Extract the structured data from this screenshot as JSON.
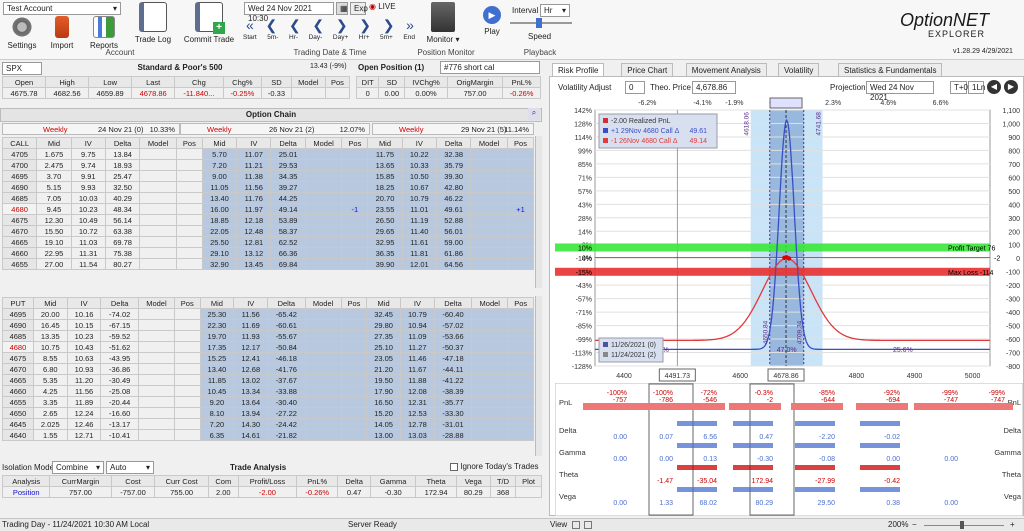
{
  "toolbar": {
    "account": "Test Account",
    "settings": "Settings",
    "import": "Import",
    "reports": "Reports",
    "tradelog": "Trade Log",
    "commit": "Commit Trade",
    "account_group": "Account",
    "date": "Wed 24 Nov 2021 10:30",
    "exp": "Exp",
    "live": "LIVE",
    "start": "Start",
    "m5": "5m-",
    "hm": "Hr-",
    "dm": "Day-",
    "dp": "Day+",
    "hp": "Hr+",
    "mp": "5m+",
    "end": "End",
    "tdt": "Trading Date & Time",
    "monitor": "Monitor",
    "pos_monitor": "Position Monitor",
    "play": "Play",
    "interval_label": "Interval",
    "interval": "Hr",
    "speed": "Speed",
    "playback": "Playback",
    "brand1": "OptionNET",
    "brand2": "EXPLORER",
    "version": "v1.28.29",
    "ver_date": "4/29/2021"
  },
  "underlying": {
    "symbol": "SPX",
    "name": "Standard & Poor's 500",
    "change": "13.43 (-9%)",
    "headers": [
      "Open",
      "High",
      "Low",
      "Last",
      "Chg",
      "Chg%",
      "SD",
      "Model",
      "Pos"
    ],
    "values": [
      "4675.78",
      "4682.56",
      "4659.89",
      "4678.86",
      "-11.840...",
      "-0.25%",
      "-0.33",
      "",
      ""
    ]
  },
  "open_position": {
    "title": "Open Position (1)",
    "name": "#776 short cal",
    "headers": [
      "DIT",
      "SD",
      "IVChg%",
      "OrigMargin",
      "PnL%"
    ],
    "values": [
      "0",
      "0.00",
      "0.00%",
      "757.00",
      "-0.26%"
    ]
  },
  "chain": {
    "title": "Option Chain",
    "header": [
      {
        "type": "Weekly",
        "date": "24 Nov 21 (0)",
        "iv": "10.33%"
      },
      {
        "type": "Weekly",
        "date": "26 Nov 21 (2)",
        "iv": "12.07%"
      },
      {
        "type": "Weekly",
        "date": "29 Nov 21 (5)",
        "iv": "11.14%"
      }
    ],
    "cols_left": [
      "CALL",
      "Mid",
      "IV",
      "Delta",
      "Model",
      "Pos"
    ],
    "cols": [
      "Mid",
      "IV",
      "Delta",
      "Model",
      "Pos"
    ],
    "calls": [
      [
        "4705",
        "1.675",
        "9.75",
        "13.84",
        "",
        "",
        "5.70",
        "11.07",
        "25.01",
        "",
        "",
        "11.75",
        "10.22",
        "32.38",
        "",
        ""
      ],
      [
        "4700",
        "2.475",
        "9.74",
        "18.93",
        "",
        "",
        "7.20",
        "11.21",
        "29.53",
        "",
        "",
        "13.65",
        "10.33",
        "35.79",
        "",
        ""
      ],
      [
        "4695",
        "3.70",
        "9.91",
        "25.47",
        "",
        "",
        "9.00",
        "11.38",
        "34.35",
        "",
        "",
        "15.85",
        "10.50",
        "39.30",
        "",
        ""
      ],
      [
        "4690",
        "5.15",
        "9.93",
        "32.50",
        "",
        "",
        "11.05",
        "11.56",
        "39.27",
        "",
        "",
        "18.25",
        "10.67",
        "42.80",
        "",
        ""
      ],
      [
        "4685",
        "7.05",
        "10.03",
        "40.29",
        "",
        "",
        "13.40",
        "11.76",
        "44.25",
        "",
        "",
        "20.70",
        "10.79",
        "46.22",
        "",
        ""
      ],
      [
        "4680",
        "9.45",
        "10.23",
        "48.34",
        "",
        "",
        "16.00",
        "11.97",
        "49.14",
        "",
        "-1",
        "23.55",
        "11.01",
        "49.61",
        "",
        "+1"
      ],
      [
        "4675",
        "12.30",
        "10.49",
        "56.14",
        "",
        "",
        "18.85",
        "12.18",
        "53.89",
        "",
        "",
        "26.50",
        "11.19",
        "52.88",
        "",
        ""
      ],
      [
        "4670",
        "15.50",
        "10.72",
        "63.38",
        "",
        "",
        "22.05",
        "12.48",
        "58.37",
        "",
        "",
        "29.65",
        "11.40",
        "56.01",
        "",
        ""
      ],
      [
        "4665",
        "19.10",
        "11.03",
        "69.78",
        "",
        "",
        "25.50",
        "12.81",
        "62.52",
        "",
        "",
        "32.95",
        "11.61",
        "59.00",
        "",
        ""
      ],
      [
        "4660",
        "22.95",
        "11.31",
        "75.38",
        "",
        "",
        "29.10",
        "13.12",
        "66.36",
        "",
        "",
        "36.35",
        "11.81",
        "61.86",
        "",
        ""
      ],
      [
        "4655",
        "27.00",
        "11.54",
        "80.27",
        "",
        "",
        "32.90",
        "13.45",
        "69.84",
        "",
        "",
        "39.90",
        "12.01",
        "64.56",
        "",
        ""
      ]
    ],
    "puts": [
      [
        "4695",
        "20.00",
        "10.16",
        "-74.02",
        "",
        "",
        "25.30",
        "11.56",
        "-65.42",
        "",
        "",
        "32.45",
        "10.79",
        "-60.40",
        "",
        ""
      ],
      [
        "4690",
        "16.45",
        "10.15",
        "-67.15",
        "",
        "",
        "22.30",
        "11.69",
        "-60.61",
        "",
        "",
        "29.80",
        "10.94",
        "-57.02",
        "",
        ""
      ],
      [
        "4685",
        "13.35",
        "10.23",
        "-59.52",
        "",
        "",
        "19.70",
        "11.93",
        "-55.67",
        "",
        "",
        "27.35",
        "11.09",
        "-53.66",
        "",
        ""
      ],
      [
        "4680",
        "10.75",
        "10.43",
        "-51.62",
        "",
        "",
        "17.35",
        "12.17",
        "-50.84",
        "",
        "",
        "25.10",
        "11.27",
        "-50.37",
        "",
        ""
      ],
      [
        "4675",
        "8.55",
        "10.63",
        "-43.95",
        "",
        "",
        "15.25",
        "12.41",
        "-46.18",
        "",
        "",
        "23.05",
        "11.46",
        "-47.18",
        "",
        ""
      ],
      [
        "4670",
        "6.80",
        "10.93",
        "-36.86",
        "",
        "",
        "13.40",
        "12.68",
        "-41.76",
        "",
        "",
        "21.20",
        "11.67",
        "-44.11",
        "",
        ""
      ],
      [
        "4665",
        "5.35",
        "11.20",
        "-30.49",
        "",
        "",
        "11.85",
        "13.02",
        "-37.67",
        "",
        "",
        "19.50",
        "11.88",
        "-41.22",
        "",
        ""
      ],
      [
        "4660",
        "4.25",
        "11.56",
        "-25.08",
        "",
        "",
        "10.45",
        "13.34",
        "-33.88",
        "",
        "",
        "17.90",
        "12.08",
        "-38.39",
        "",
        ""
      ],
      [
        "4655",
        "3.35",
        "11.89",
        "-20.44",
        "",
        "",
        "9.20",
        "13.64",
        "-30.40",
        "",
        "",
        "16.50",
        "12.31",
        "-35.77",
        "",
        ""
      ],
      [
        "4650",
        "2.65",
        "12.24",
        "-16.60",
        "",
        "",
        "8.10",
        "13.94",
        "-27.22",
        "",
        "",
        "15.20",
        "12.53",
        "-33.30",
        "",
        ""
      ],
      [
        "4645",
        "2.025",
        "12.46",
        "-13.17",
        "",
        "",
        "7.20",
        "14.30",
        "-24.42",
        "",
        "",
        "14.05",
        "12.78",
        "-31.01",
        "",
        ""
      ],
      [
        "4640",
        "1.55",
        "12.71",
        "-10.41",
        "",
        "",
        "6.35",
        "14.61",
        "-21.82",
        "",
        "",
        "13.00",
        "13.03",
        "-28.88",
        "",
        ""
      ]
    ]
  },
  "trade_analysis": {
    "iso_label": "Isolation Mode",
    "iso_val": "Combine",
    "auto": "Auto",
    "title": "Trade Analysis",
    "ignore": "Ignore Today's Trades",
    "headers": [
      "Analysis",
      "CurrMargin",
      "Cost",
      "Curr Cost",
      "Com",
      "Profit/Loss",
      "PnL%",
      "Delta",
      "Gamma",
      "Theta",
      "Vega",
      "T/D",
      "Plot"
    ],
    "values": [
      "Position",
      "757.00",
      "-757.00",
      "755.00",
      "2.00",
      "-2.00",
      "-0.26%",
      "0.47",
      "-0.30",
      "172.94",
      "80.29",
      "368",
      ""
    ]
  },
  "tabs": [
    "Risk Profile",
    "Price Chart",
    "Movement Analysis",
    "Volatility",
    "Statistics & Fundamentals"
  ],
  "risk": {
    "vol_adjust_label": "Volatility Adjust",
    "vol_adjust": "0",
    "theo_label": "Theo. Price",
    "theo": "4,678.86",
    "proj_label": "Projection",
    "proj_date": "Wed 24 Nov 2021",
    "t0": "T+0",
    "oneln": "1Ln",
    "top_pct": [
      "-6.2%",
      "-4.1%",
      "-1.9%",
      "-0.3%",
      "2.3%",
      "4.6%",
      "6.6%"
    ],
    "left_pct": [
      "142%",
      "128%",
      "114%",
      "99%",
      "85%",
      "71%",
      "57%",
      "43%",
      "28%",
      "14%",
      "0%",
      "-14%",
      "-28%",
      "-43%",
      "-57%",
      "-71%",
      "-85%",
      "-99%",
      "-113%",
      "-128%"
    ],
    "right_usd": [
      "1,100",
      "1,000",
      "900",
      "800",
      "700",
      "600",
      "500",
      "400",
      "300",
      "200",
      "100",
      "0",
      "-100",
      "-200",
      "-300",
      "-400",
      "-500",
      "-600",
      "-700",
      "-800"
    ],
    "x_ticks": [
      "4400",
      "4491.73",
      "4600",
      "4678.86",
      "4800",
      "4900",
      "5000"
    ],
    "legend1": [
      "-2.00 Realized PnL",
      "+1 29Nov 4680 Call Δ",
      "-1 26Nov 4680 Call Δ"
    ],
    "legend1_vals": [
      "",
      "49.61",
      "49.14"
    ],
    "legend2": [
      "11/26/2021 (0)",
      "11/24/2021 (2)"
    ],
    "profit_target": "Profit Target 76",
    "pt_val": "76",
    "pt_pct": "10%",
    "max_loss": "Max Loss -114",
    "ml_pct": "-15%",
    "zero_pct": "0%",
    "zero_val": "-2",
    "ann_274": "27.4%",
    "ann_470": "47.0%",
    "ann_256": "25.6%",
    "ann_4650": "4650.84",
    "ann_4709": "4709.34",
    "ann_a": "4618.06",
    "ann_b": "4741.68",
    "colors": {
      "blue": "#3a4ec4",
      "red": "#e03a3a",
      "band": "#c9e3f7",
      "band2": "#99b8de"
    }
  },
  "greeks": {
    "labels": [
      "PnL",
      "Delta",
      "Gamma",
      "Theta",
      "Vega"
    ],
    "col1": {
      "pnl_pct": "-100%",
      "pnl": "-757",
      "delta": "0.00",
      "gamma": "0.00",
      "theta": "",
      "vega": "0.00"
    },
    "col2": {
      "pnl_pct": "-100%",
      "pnl": "-786",
      "delta": "0.07",
      "gamma": "0.00",
      "theta": "-1.47",
      "vega": "1.33"
    },
    "col3": {
      "pnl_pct": "-72%",
      "pnl": "-546",
      "delta": "6.56",
      "gamma": "0.13",
      "theta": "-35.04",
      "vega": "68.02"
    },
    "col4": {
      "pnl_pct": "-0.3%",
      "pnl": "-2",
      "delta": "0.47",
      "gamma": "-0.30",
      "theta": "172.94",
      "vega": "80.29"
    },
    "col5": {
      "pnl_pct": "-85%",
      "pnl": "-644",
      "delta": "-2.20",
      "gamma": "-0.08",
      "theta": "-27.99",
      "vega": "29.50"
    },
    "col6": {
      "pnl_pct": "-92%",
      "pnl": "-694",
      "delta": "-0.02",
      "gamma": "0.00",
      "theta": "-0.42",
      "vega": "0.38"
    },
    "col7": {
      "pnl_pct": "-99%",
      "pnl": "-747",
      "delta": "",
      "gamma": "0.00",
      "theta": "",
      "vega": "0.00"
    },
    "col8": {
      "pnl_pct": "-99%",
      "pnl": "-747",
      "delta": "",
      "gamma": "",
      "theta": "",
      "vega": ""
    }
  },
  "status": {
    "left": "Trading Day - 11/24/2021 10:30 AM Local",
    "server": "Server Ready",
    "view": "View",
    "zoom": "200%"
  }
}
